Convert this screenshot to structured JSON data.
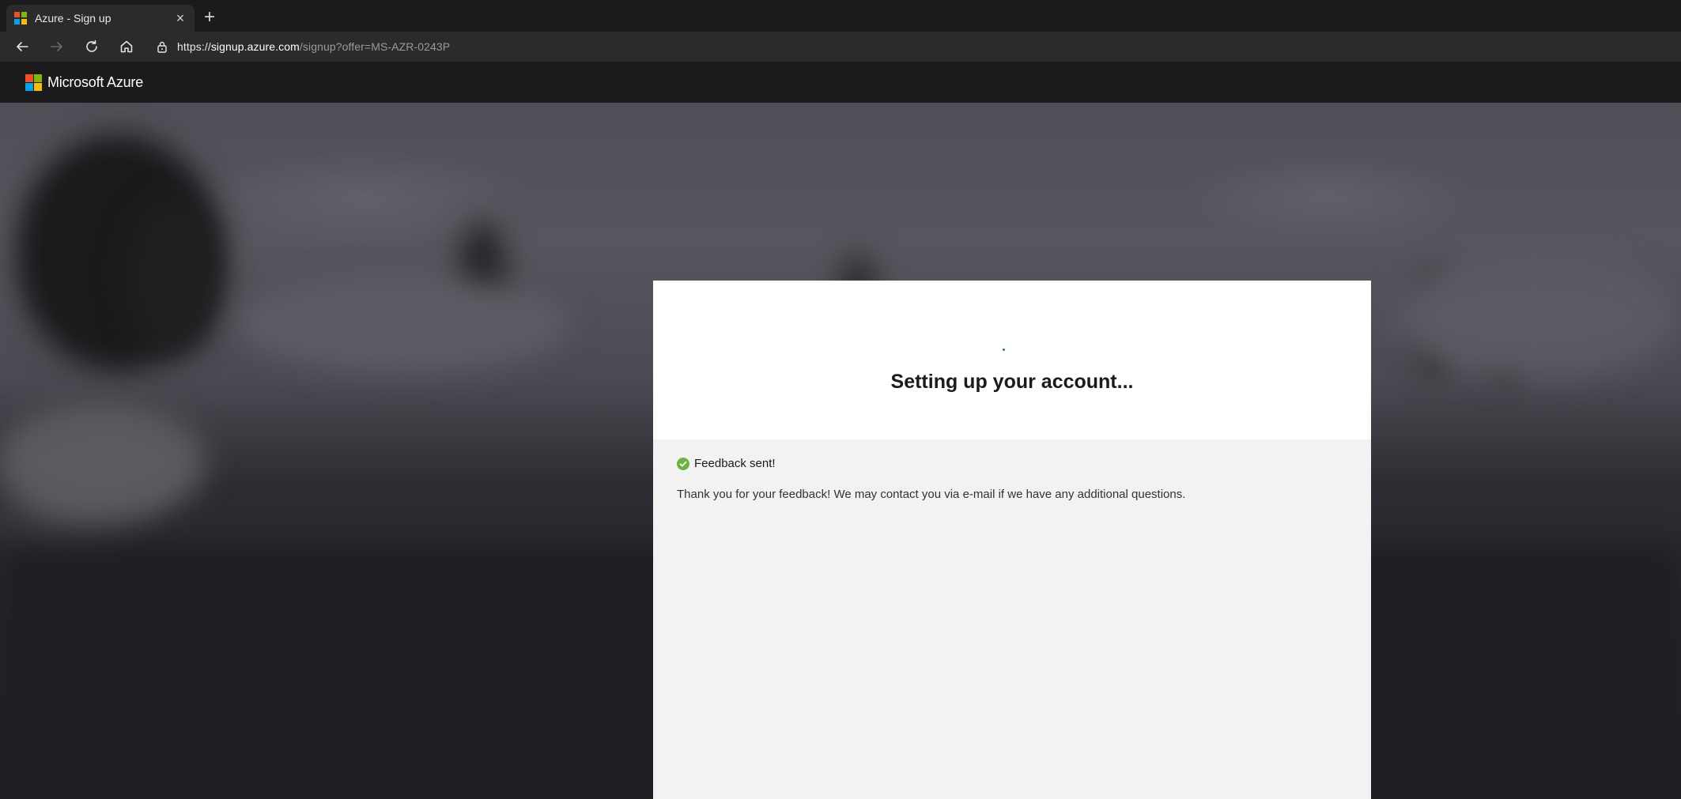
{
  "browser": {
    "tab_title": "Azure - Sign up",
    "tab_close_glyph": "×",
    "new_tab_glyph": "+",
    "url_scheme": "https://",
    "url_host": "signup.azure.com",
    "url_path": "/signup?offer=MS-AZR-0243P",
    "icons": [
      "back-icon",
      "forward-icon",
      "reload-icon",
      "home-icon",
      "lock-icon"
    ]
  },
  "header": {
    "brand": "Microsoft Azure",
    "logo_colors": [
      "#f25022",
      "#7fba00",
      "#00a4ef",
      "#ffb900"
    ]
  },
  "card": {
    "title": "Setting up your account...",
    "feedback_status": "Feedback sent!",
    "feedback_message": "Thank you for your feedback! We may contact you via e-mail if we have any additional questions."
  },
  "colors": {
    "accent": "#0078d4",
    "success": "#6bb33a"
  }
}
